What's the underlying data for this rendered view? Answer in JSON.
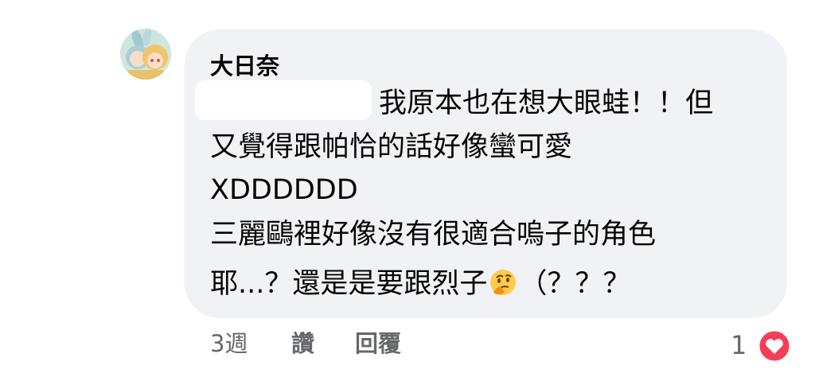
{
  "comment": {
    "author": "大日奈",
    "lines": [
      "我原本也在想大眼蛙！！但",
      "又覺得跟帕恰的話好像蠻可愛",
      "XDDDDDD",
      "三麗鷗裡好像沒有很適合嗚子的角色",
      "耶...？還是是要跟烈子"
    ],
    "last_line_suffix": "（？？？",
    "emoji_icon": "thinking-face-emoji",
    "timestamp": "3週",
    "like_label": "讚",
    "reply_label": "回覆",
    "reaction_count": "1",
    "reaction_icon": "heart-reaction-icon"
  },
  "colors": {
    "bubble": "#f0f2f5",
    "text": "#050505",
    "meta": "#65676b",
    "heart": "#f33e58"
  }
}
